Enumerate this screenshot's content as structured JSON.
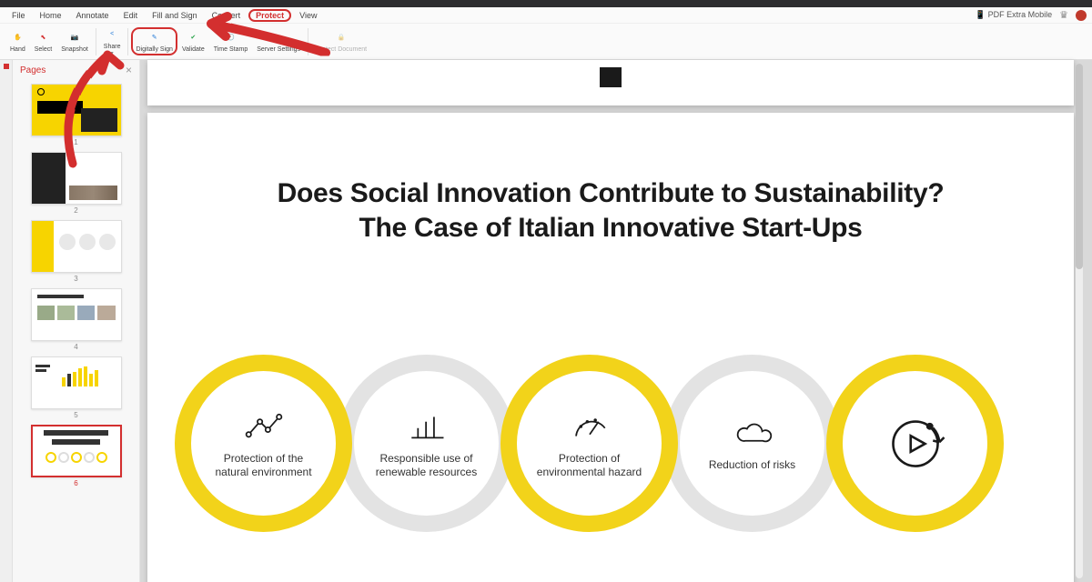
{
  "menus": {
    "items": [
      "File",
      "Home",
      "Annotate",
      "Edit",
      "Fill and Sign",
      "Convert",
      "Protect",
      "View"
    ],
    "active_index": 6,
    "right": {
      "app": "PDF Extra Mobile"
    }
  },
  "ribbon": {
    "items": [
      {
        "label": "Hand"
      },
      {
        "label": "Select"
      },
      {
        "label": "Snapshot"
      },
      {
        "label": "Share"
      },
      {
        "label": "Digitally Sign",
        "circled": true
      },
      {
        "label": "Validate"
      },
      {
        "label": "Time Stamp"
      },
      {
        "label": "Server Settings"
      },
      {
        "label": "Protect Document"
      }
    ]
  },
  "sidebar": {
    "title": "Pages",
    "thumbnails": [
      1,
      2,
      3,
      4,
      5,
      6
    ],
    "selected": 6
  },
  "page": {
    "title_line1": "Does Social Innovation Contribute to Sustainability?",
    "title_line2": "The Case of Italian Innovative Start-Ups",
    "circles": [
      {
        "label": "Protection of the natural environment"
      },
      {
        "label": "Responsible use of renewable resources"
      },
      {
        "label": "Protection of environmental hazard"
      },
      {
        "label": "Reduction of risks"
      },
      {
        "label": ""
      }
    ]
  }
}
